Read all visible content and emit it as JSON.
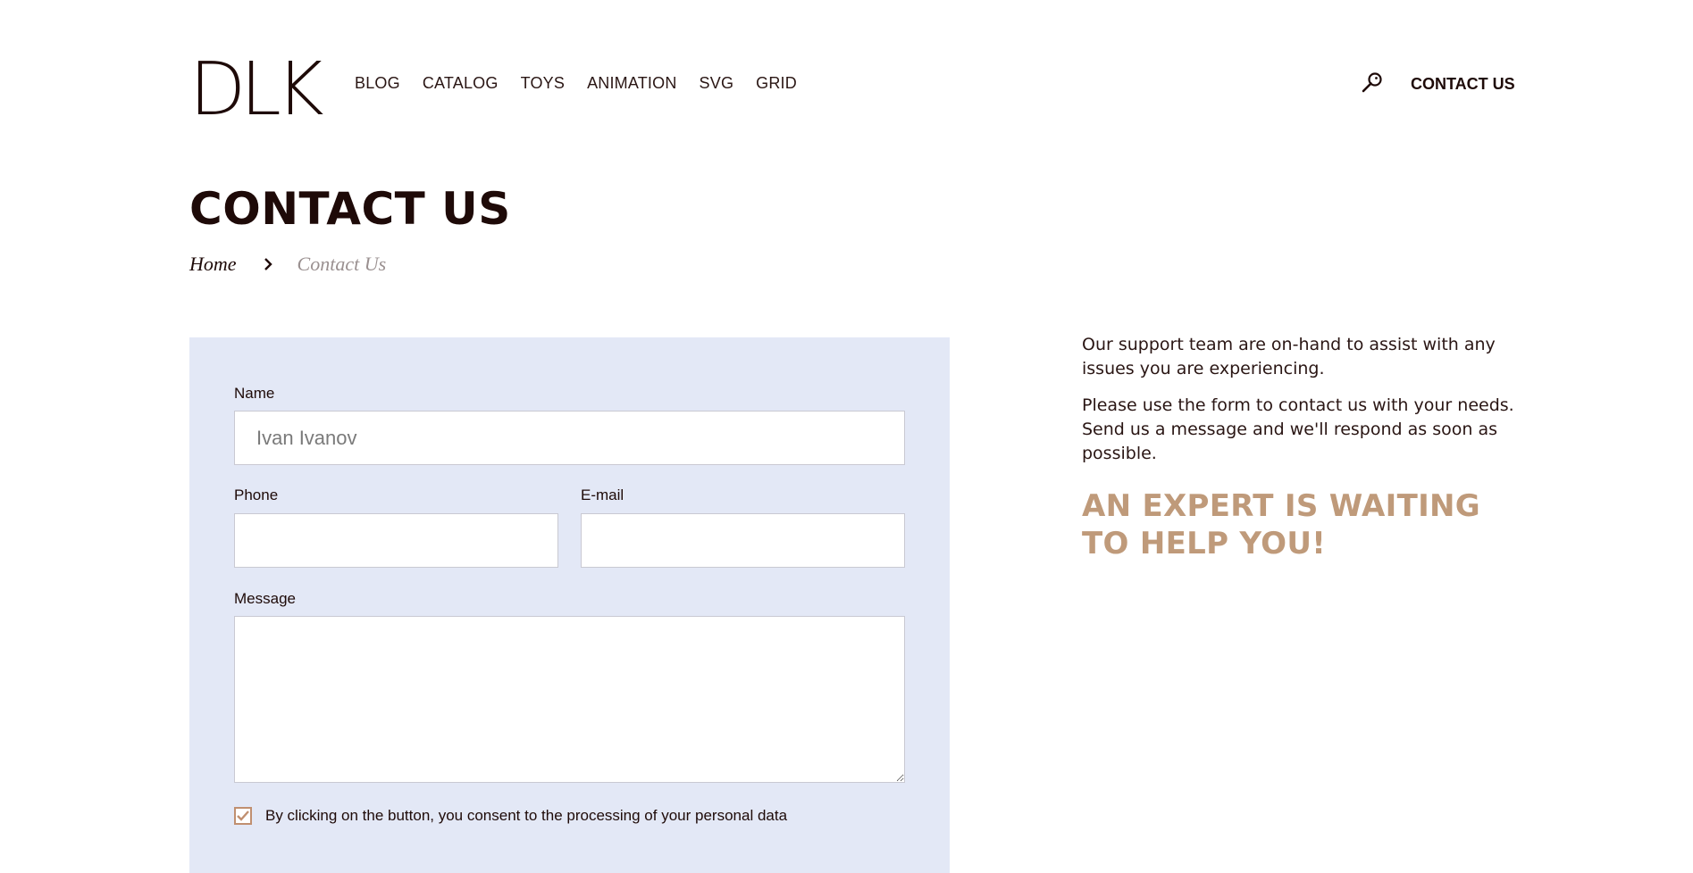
{
  "header": {
    "logo": "DLK",
    "nav": [
      "BLOG",
      "CATALOG",
      "TOYS",
      "ANIMATION",
      "SVG",
      "GRID"
    ],
    "search_icon": "search-icon",
    "contact_label": "CONTACT US"
  },
  "page": {
    "title": "CONTACT US",
    "breadcrumb": {
      "home": "Home",
      "current": "Contact Us"
    }
  },
  "form": {
    "name_label": "Name",
    "name_value": "Ivan Ivanov",
    "phone_label": "Phone",
    "phone_value": "",
    "email_label": "E-mail",
    "email_value": "",
    "message_label": "Message",
    "message_value": "",
    "consent_text": "By clicking on the button, you consent to the processing of your personal data",
    "consent_checked": true
  },
  "info": {
    "paragraph1": "Our support team are on-hand to assist with any issues you are experiencing.",
    "paragraph2": "Please use the form to contact us with your needs. Send us a message and we'll respond as soon as possible.",
    "cta": "AN EXPERT IS WAITING TO HELP YOU!"
  },
  "colors": {
    "text_dark": "#1e0a08",
    "accent": "#bf9a7a",
    "form_bg": "#e3e8f6",
    "checkbox": "#c08f70"
  }
}
